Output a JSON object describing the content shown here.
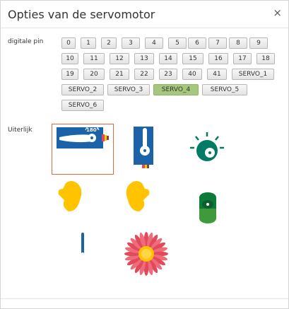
{
  "dialog": {
    "title": "Opties van de servomotor",
    "close": "×"
  },
  "pin": {
    "label": "digitale pin",
    "options": [
      "0",
      "1",
      "2",
      "3",
      "4",
      "5",
      "6",
      "7",
      "8",
      "9",
      "10",
      "11",
      "12",
      "13",
      "14",
      "15",
      "16",
      "17",
      "18",
      "19",
      "20",
      "21",
      "22",
      "23",
      "40",
      "41",
      "SERVO_1",
      "SERVO_2",
      "SERVO_3",
      "SERVO_4",
      "SERVO_5",
      "SERVO_6"
    ],
    "selected": "SERVO_4"
  },
  "appearance": {
    "label": "Uiterlijk",
    "selected_index": 0,
    "options": [
      {
        "icon": "servo-horizontal-icon",
        "text": "180°"
      },
      {
        "icon": "servo-vertical-icon"
      },
      {
        "icon": "dial-gauge-icon"
      },
      {
        "icon": "mitten-left-icon"
      },
      {
        "icon": "mitten-right-icon"
      },
      {
        "icon": "cylinder-icon"
      },
      {
        "icon": "needle-icon"
      },
      {
        "icon": "flower-icon"
      }
    ]
  },
  "colors": {
    "selected": "#a6c87c",
    "accent": "#e0693e",
    "servo_blue": "#1c62a8",
    "teal": "#007c66",
    "yellow": "#ffc300",
    "red": "#e14a5a"
  }
}
